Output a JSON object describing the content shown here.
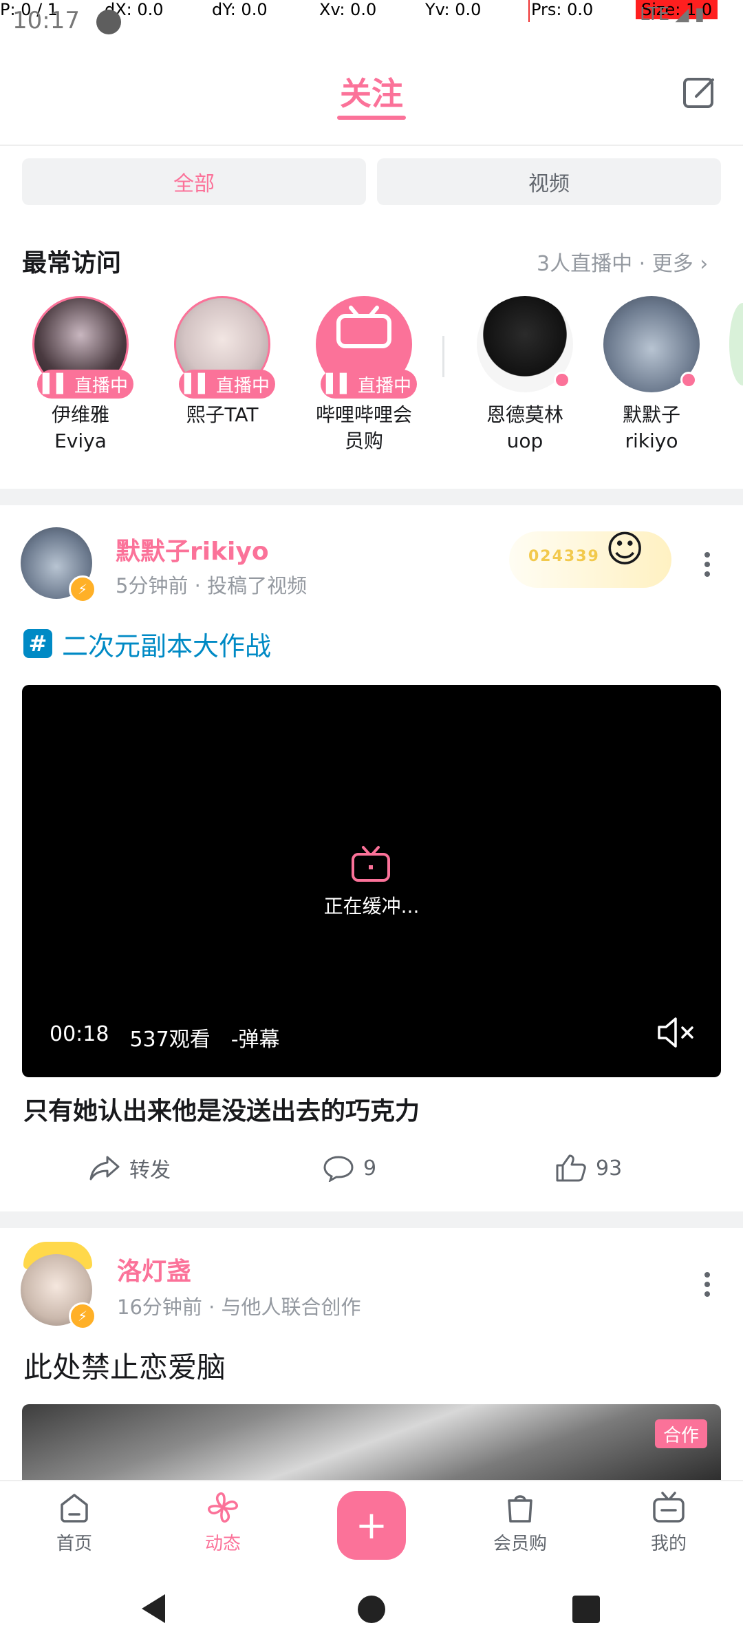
{
  "debug_overlay": {
    "p": "P: 0 / 1",
    "dx": "dX: 0.0",
    "dy": "dY: 0.0",
    "xv": "Xv: 0.0",
    "yv": "Yv: 0.0",
    "prs": "Prs: 0.0",
    "size": "Size: 1.0"
  },
  "status_bar": {
    "time": "10:17",
    "network": "LTE"
  },
  "header": {
    "title": "关注"
  },
  "filter_tabs": [
    {
      "label": "全部",
      "active": true
    },
    {
      "label": "视频",
      "active": false
    }
  ],
  "frequent": {
    "title": "最常访问",
    "more": "3人直播中 · 更多",
    "live_label": "直播中",
    "users": [
      {
        "name_line1": "伊维雅",
        "name_line2": "Eviya",
        "live": true
      },
      {
        "name_line1": "熙子TAT",
        "name_line2": "",
        "live": true
      },
      {
        "name_line1": "哔哩哔哩会",
        "name_line2": "员购",
        "live": true
      },
      {
        "name_line1": "恩德莫林",
        "name_line2": "uop",
        "live": false
      },
      {
        "name_line1": "默默子",
        "name_line2": "rikiyo",
        "live": false
      }
    ]
  },
  "post1": {
    "author": "默默子rikiyo",
    "meta": "5分钟前 · 投稿了视频",
    "badge_number": "024339",
    "topic": "二次元副本大作战",
    "video": {
      "buffering_text": "正在缓冲...",
      "duration": "00:18",
      "views": "537观看",
      "danmaku": "-弹幕"
    },
    "title": "只有她认出来他是没送出去的巧克力",
    "actions": {
      "share": "转发",
      "comments": "9",
      "likes": "93"
    }
  },
  "post2": {
    "author": "洛灯盏",
    "meta": "16分钟前 · 与他人联合创作",
    "text": "此处禁止恋爱脑",
    "badge": "合作"
  },
  "bottom_nav": [
    {
      "label": "首页",
      "active": false
    },
    {
      "label": "动态",
      "active": true
    },
    {
      "label": "会员购",
      "active": false
    },
    {
      "label": "我的",
      "active": false
    }
  ],
  "colors": {
    "brand_pink": "#fb7299",
    "topic_blue": "#008ac5",
    "grey_text": "#9499a0"
  }
}
